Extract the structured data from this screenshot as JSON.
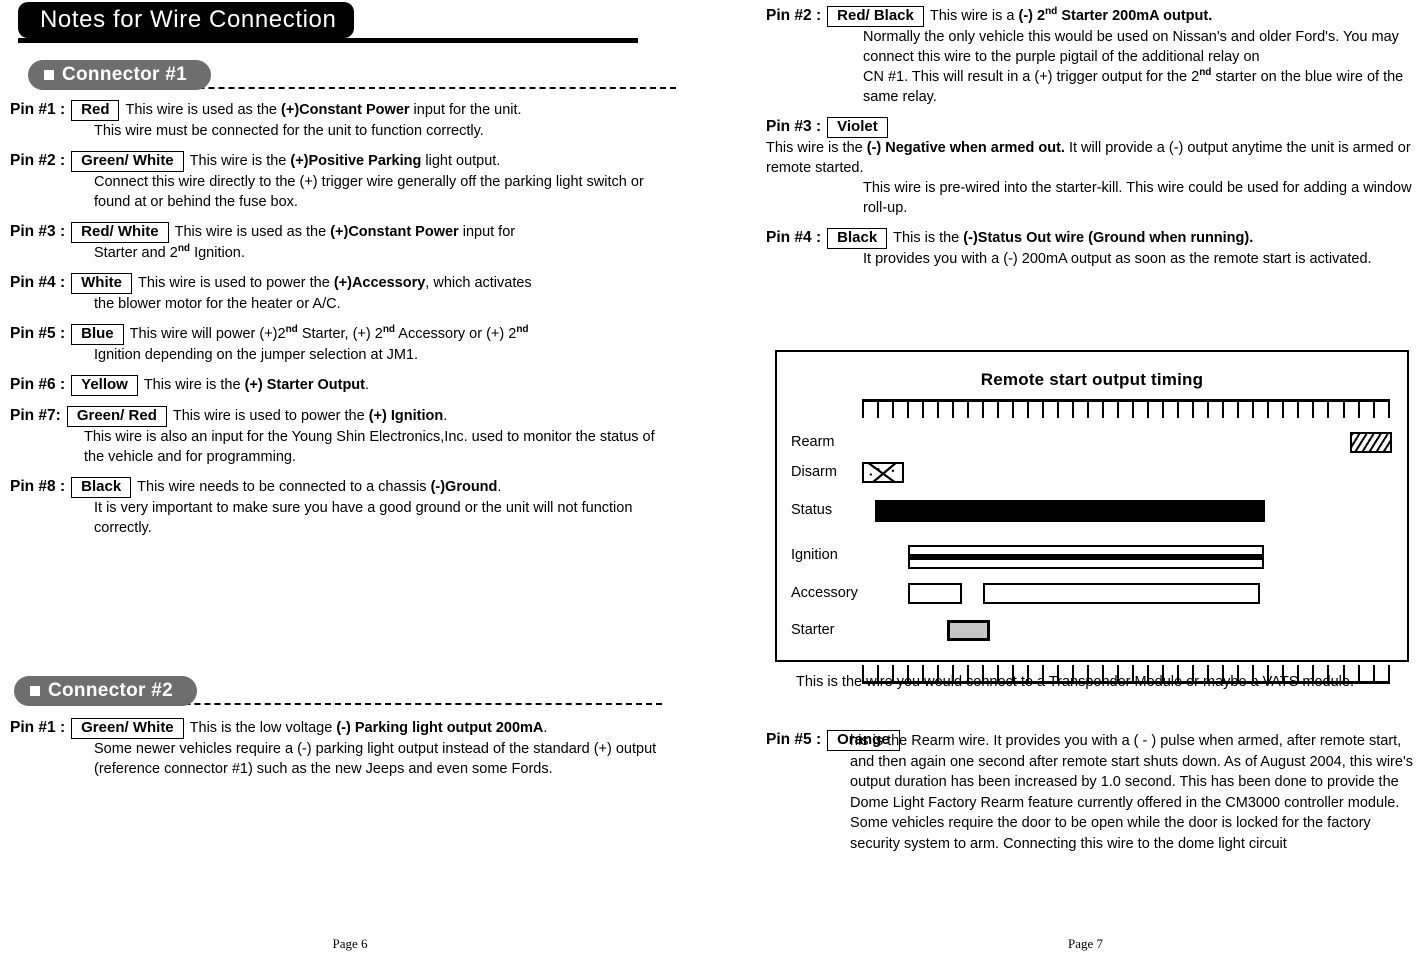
{
  "document": {
    "title": "Notes for Wire Connection"
  },
  "left_page": {
    "page_number": "Page 6",
    "connector1": {
      "label": "Connector #1",
      "pins": [
        {
          "pin": "Pin #1 :",
          "wire": "Red",
          "lead_pre": "This wire is used as the ",
          "lead_bold": "(+)Constant Power",
          "lead_post": " input for the unit.",
          "cont": "This wire must be connected for the unit to function correctly."
        },
        {
          "pin": "Pin #2 :",
          "wire": "Green/ White",
          "lead_pre": "This wire is the ",
          "lead_bold": "(+)Positive Parking",
          "lead_post": " light output.",
          "cont": "Connect this wire directly to the (+) trigger wire generally off the parking light switch or found at or behind the fuse box."
        },
        {
          "pin": "Pin #3 :",
          "wire": "Red/ White",
          "lead_pre": "This wire is used as the ",
          "lead_bold": "(+)Constant Power",
          "lead_post": " input for",
          "cont_pre": "Starter and 2",
          "cont_sup": "nd",
          "cont_post": "  Ignition."
        },
        {
          "pin": "Pin #4 :",
          "wire": "White",
          "lead_pre": "This wire is used to power the ",
          "lead_bold": "(+)Accessory",
          "lead_post": ", which activates",
          "cont": "the blower motor for the heater or A/C."
        },
        {
          "pin": "Pin #5 :",
          "wire": "Blue",
          "lead_pre": "This wire will power (+)2",
          "lead_sup1": "nd",
          "lead_mid1": " Starter, (+) 2",
          "lead_sup2": "nd",
          "lead_mid2": " Accessory or (+) 2",
          "lead_sup3": "nd",
          "cont": "Ignition depending on the jumper selection at JM1."
        },
        {
          "pin": "Pin #6 :",
          "wire": "Yellow",
          "lead_pre": "This wire is the ",
          "lead_bold": "(+) Starter Output",
          "lead_post": "."
        },
        {
          "pin": "Pin #7:",
          "wire": "Green/ Red",
          "lead_pre": "This wire is used to power the ",
          "lead_bold": "(+) Ignition",
          "lead_post": ".",
          "cont": "This wire is also an input for the Young Shin Electronics,Inc. used to monitor the status of  the vehicle and for programming."
        },
        {
          "pin": "Pin #8 :",
          "wire": "Black",
          "lead_pre": "This wire needs to be connected to a chassis ",
          "lead_bold": "(-)Ground",
          "lead_post": ".",
          "cont": "It is very important to make sure you have a good ground or the unit will not function correctly."
        }
      ]
    },
    "connector2": {
      "label": "Connector #2",
      "pins": [
        {
          "pin": "Pin #1 :",
          "wire": "Green/ White",
          "lead_pre": "This is the low voltage ",
          "lead_bold": "(-) Parking light output 200mA",
          "lead_post": ".",
          "cont": "Some newer vehicles require a (-) parking light output instead of the standard (+) output (reference connector #1) such as the new Jeeps and even some Fords."
        }
      ]
    }
  },
  "right_page": {
    "page_number": "Page 7",
    "pins": [
      {
        "pin": "Pin #2 :",
        "wire": "Red/ Black",
        "lead_pre": "This wire is a ",
        "lead_bold_a": "(-) 2",
        "lead_sup": "nd",
        "lead_bold_b": " Starter 200mA output.",
        "cont1": "Normally the only vehicle this  would be used on Nissan's and older Ford's. You may connect this wire to the purple pigtail of the additional relay on",
        "cont2_pre": "CN #1.  This will result in a (+) trigger output for the 2",
        "cont2_sup": "nd",
        "cont2_post": " starter on the blue wire of the same relay."
      },
      {
        "pin": "Pin #3 :",
        "wire": "Violet",
        "lead_pre": "This wire is the ",
        "lead_bold": "(-) Negative when armed out.",
        "lead_post": "  It will provide a (-) output anytime the unit is armed or remote started.",
        "cont": "This wire is pre-wired into the starter-kill. This wire could be used for adding a window roll-up."
      },
      {
        "pin": "Pin #4 :",
        "wire": "Black",
        "lead_pre": "This is the ",
        "lead_bold": "(-)Status Out wire (Ground when running).",
        "lead_post": "",
        "cont": "It provides you with a (-) 200mA output as soon as the remote start is activated."
      }
    ],
    "caption": "This is the wire you would connect to a Transponder Module or maybe a VATS module.",
    "pin5": {
      "pin": "Pin #5 :",
      "wire": "Orange",
      "text": "his is the Rearm wire. It provides you with a ( - ) pulse when armed, after remote start, and then again one second after remote start shuts down. As of August 2004, this wire's output duration has been increased by 1.0 second.  This has been done to provide the Dome Light Factory Rearm feature currently offered in the CM3000 controller module. Some vehicles require the door to be open while the door is locked for the factory security system to arm. Connecting this wire to the dome light circuit"
    }
  },
  "timing_diagram": {
    "title": "Remote start output timing",
    "ruler_ticks": 36,
    "traces": [
      {
        "name": "Rearm",
        "style": "hatched",
        "start_pct": 92.5,
        "width_pct": 7.0
      },
      {
        "name": "Disarm",
        "style": "speckled",
        "start_pct": 0.0,
        "width_pct": 7.5
      },
      {
        "name": "Status",
        "style": "solid",
        "start_pct": 5.5,
        "width_pct": 73.0
      },
      {
        "name": "Ignition",
        "style": "ignition",
        "start_pct": 11.0,
        "width_pct": 65.0
      },
      {
        "name": "Accessory",
        "style": "hollow",
        "start_pct": 11.0,
        "width_pct": 9.0
      },
      {
        "name": "Accessory2",
        "style": "hollow",
        "start_pct": 24.5,
        "width_pct": 51.5
      },
      {
        "name": "Starter",
        "style": "gray",
        "start_pct": 16.0,
        "width_pct": 6.5
      }
    ]
  }
}
